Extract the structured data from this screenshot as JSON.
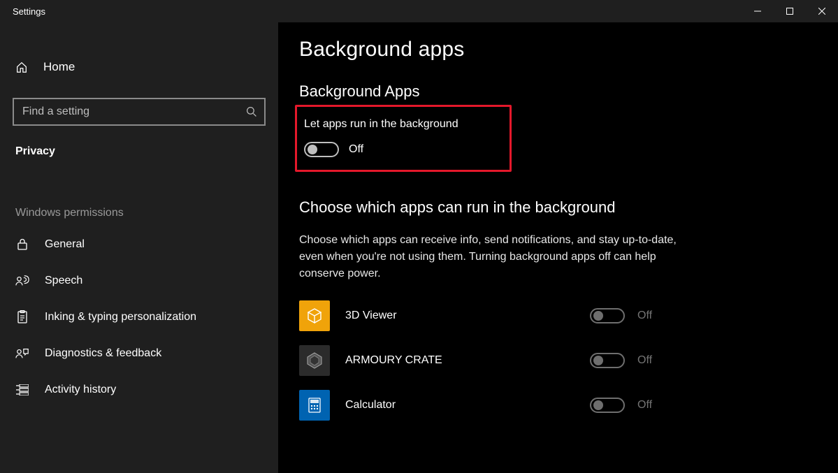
{
  "titlebar": {
    "title": "Settings"
  },
  "sidebar": {
    "home_label": "Home",
    "search_placeholder": "Find a setting",
    "category_label": "Privacy",
    "section_label": "Windows permissions",
    "items": [
      {
        "label": "General"
      },
      {
        "label": "Speech"
      },
      {
        "label": "Inking & typing personalization"
      },
      {
        "label": "Diagnostics & feedback"
      },
      {
        "label": "Activity history"
      }
    ]
  },
  "main": {
    "page_title": "Background apps",
    "section1_title": "Background Apps",
    "master_toggle_label": "Let apps run in the background",
    "master_toggle_state": "Off",
    "section2_title": "Choose which apps can run in the background",
    "help_text": "Choose which apps can receive info, send notifications, and stay up-to-date, even when you're not using them. Turning background apps off can help conserve power.",
    "apps": [
      {
        "name": "3D Viewer",
        "state": "Off"
      },
      {
        "name": "ARMOURY CRATE",
        "state": "Off"
      },
      {
        "name": "Calculator",
        "state": "Off"
      }
    ]
  }
}
